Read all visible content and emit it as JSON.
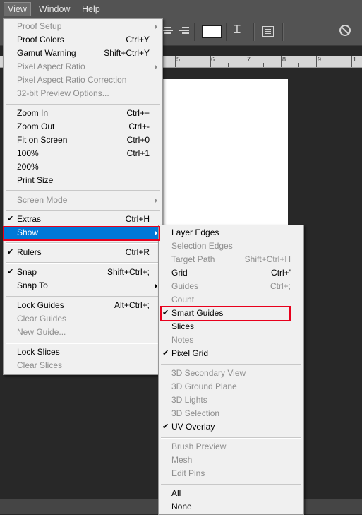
{
  "menubar": {
    "view": "View",
    "window": "Window",
    "help": "Help"
  },
  "ruler": {
    "labels": [
      "5",
      "6",
      "7",
      "8",
      "9",
      "1"
    ]
  },
  "view_menu": {
    "items": [
      {
        "label": "Proof Setup",
        "shortcut": "",
        "submenu": true,
        "disabled": true,
        "checked": false
      },
      {
        "label": "Proof Colors",
        "shortcut": "Ctrl+Y",
        "submenu": false,
        "disabled": false,
        "checked": false
      },
      {
        "label": "Gamut Warning",
        "shortcut": "Shift+Ctrl+Y",
        "submenu": false,
        "disabled": false,
        "checked": false
      },
      {
        "label": "Pixel Aspect Ratio",
        "shortcut": "",
        "submenu": true,
        "disabled": true,
        "checked": false
      },
      {
        "label": "Pixel Aspect Ratio Correction",
        "shortcut": "",
        "submenu": false,
        "disabled": true,
        "checked": false
      },
      {
        "label": "32-bit Preview Options...",
        "shortcut": "",
        "submenu": false,
        "disabled": true,
        "checked": false
      },
      {
        "label": "Zoom In",
        "shortcut": "Ctrl++",
        "submenu": false,
        "disabled": false,
        "checked": false
      },
      {
        "label": "Zoom Out",
        "shortcut": "Ctrl+-",
        "submenu": false,
        "disabled": false,
        "checked": false
      },
      {
        "label": "Fit on Screen",
        "shortcut": "Ctrl+0",
        "submenu": false,
        "disabled": false,
        "checked": false
      },
      {
        "label": "100%",
        "shortcut": "Ctrl+1",
        "submenu": false,
        "disabled": false,
        "checked": false
      },
      {
        "label": "200%",
        "shortcut": "",
        "submenu": false,
        "disabled": false,
        "checked": false
      },
      {
        "label": "Print Size",
        "shortcut": "",
        "submenu": false,
        "disabled": false,
        "checked": false
      },
      {
        "label": "Screen Mode",
        "shortcut": "",
        "submenu": true,
        "disabled": true,
        "checked": false
      },
      {
        "label": "Extras",
        "shortcut": "Ctrl+H",
        "submenu": false,
        "disabled": false,
        "checked": true
      },
      {
        "label": "Show",
        "shortcut": "",
        "submenu": true,
        "disabled": false,
        "checked": false,
        "highlighted": true
      },
      {
        "label": "Rulers",
        "shortcut": "Ctrl+R",
        "submenu": false,
        "disabled": false,
        "checked": true
      },
      {
        "label": "Snap",
        "shortcut": "Shift+Ctrl+;",
        "submenu": false,
        "disabled": false,
        "checked": true
      },
      {
        "label": "Snap To",
        "shortcut": "",
        "submenu": true,
        "disabled": false,
        "checked": false
      },
      {
        "label": "Lock Guides",
        "shortcut": "Alt+Ctrl+;",
        "submenu": false,
        "disabled": false,
        "checked": false
      },
      {
        "label": "Clear Guides",
        "shortcut": "",
        "submenu": false,
        "disabled": true,
        "checked": false
      },
      {
        "label": "New Guide...",
        "shortcut": "",
        "submenu": false,
        "disabled": true,
        "checked": false
      },
      {
        "label": "Lock Slices",
        "shortcut": "",
        "submenu": false,
        "disabled": false,
        "checked": false
      },
      {
        "label": "Clear Slices",
        "shortcut": "",
        "submenu": false,
        "disabled": true,
        "checked": false
      }
    ]
  },
  "show_menu": {
    "items": [
      {
        "label": "Layer Edges",
        "shortcut": "",
        "disabled": false,
        "checked": false
      },
      {
        "label": "Selection Edges",
        "shortcut": "",
        "disabled": true,
        "checked": false
      },
      {
        "label": "Target Path",
        "shortcut": "Shift+Ctrl+H",
        "disabled": true,
        "checked": false
      },
      {
        "label": "Grid",
        "shortcut": "Ctrl+'",
        "disabled": false,
        "checked": false
      },
      {
        "label": "Guides",
        "shortcut": "Ctrl+;",
        "disabled": true,
        "checked": false
      },
      {
        "label": "Count",
        "shortcut": "",
        "disabled": true,
        "checked": false
      },
      {
        "label": "Smart Guides",
        "shortcut": "",
        "disabled": false,
        "checked": true,
        "outlined": true
      },
      {
        "label": "Slices",
        "shortcut": "",
        "disabled": false,
        "checked": false
      },
      {
        "label": "Notes",
        "shortcut": "",
        "disabled": true,
        "checked": false
      },
      {
        "label": "Pixel Grid",
        "shortcut": "",
        "disabled": false,
        "checked": true
      },
      {
        "label": "3D Secondary View",
        "shortcut": "",
        "disabled": true,
        "checked": false
      },
      {
        "label": "3D Ground Plane",
        "shortcut": "",
        "disabled": true,
        "checked": false
      },
      {
        "label": "3D Lights",
        "shortcut": "",
        "disabled": true,
        "checked": false
      },
      {
        "label": "3D Selection",
        "shortcut": "",
        "disabled": true,
        "checked": false
      },
      {
        "label": "UV Overlay",
        "shortcut": "",
        "disabled": false,
        "checked": true
      },
      {
        "label": "Brush Preview",
        "shortcut": "",
        "disabled": true,
        "checked": false
      },
      {
        "label": "Mesh",
        "shortcut": "",
        "disabled": true,
        "checked": false
      },
      {
        "label": "Edit Pins",
        "shortcut": "",
        "disabled": true,
        "checked": false
      },
      {
        "label": "All",
        "shortcut": "",
        "disabled": false,
        "checked": false
      },
      {
        "label": "None",
        "shortcut": "",
        "disabled": false,
        "checked": false
      }
    ]
  },
  "colors": {
    "highlight": "#0078d7",
    "annotation": "#e8001c",
    "disabled_text": "#8d8d8d"
  },
  "icons": {
    "check": "✔",
    "warp": "warp-text-icon",
    "cancel": "cancel-icon"
  }
}
